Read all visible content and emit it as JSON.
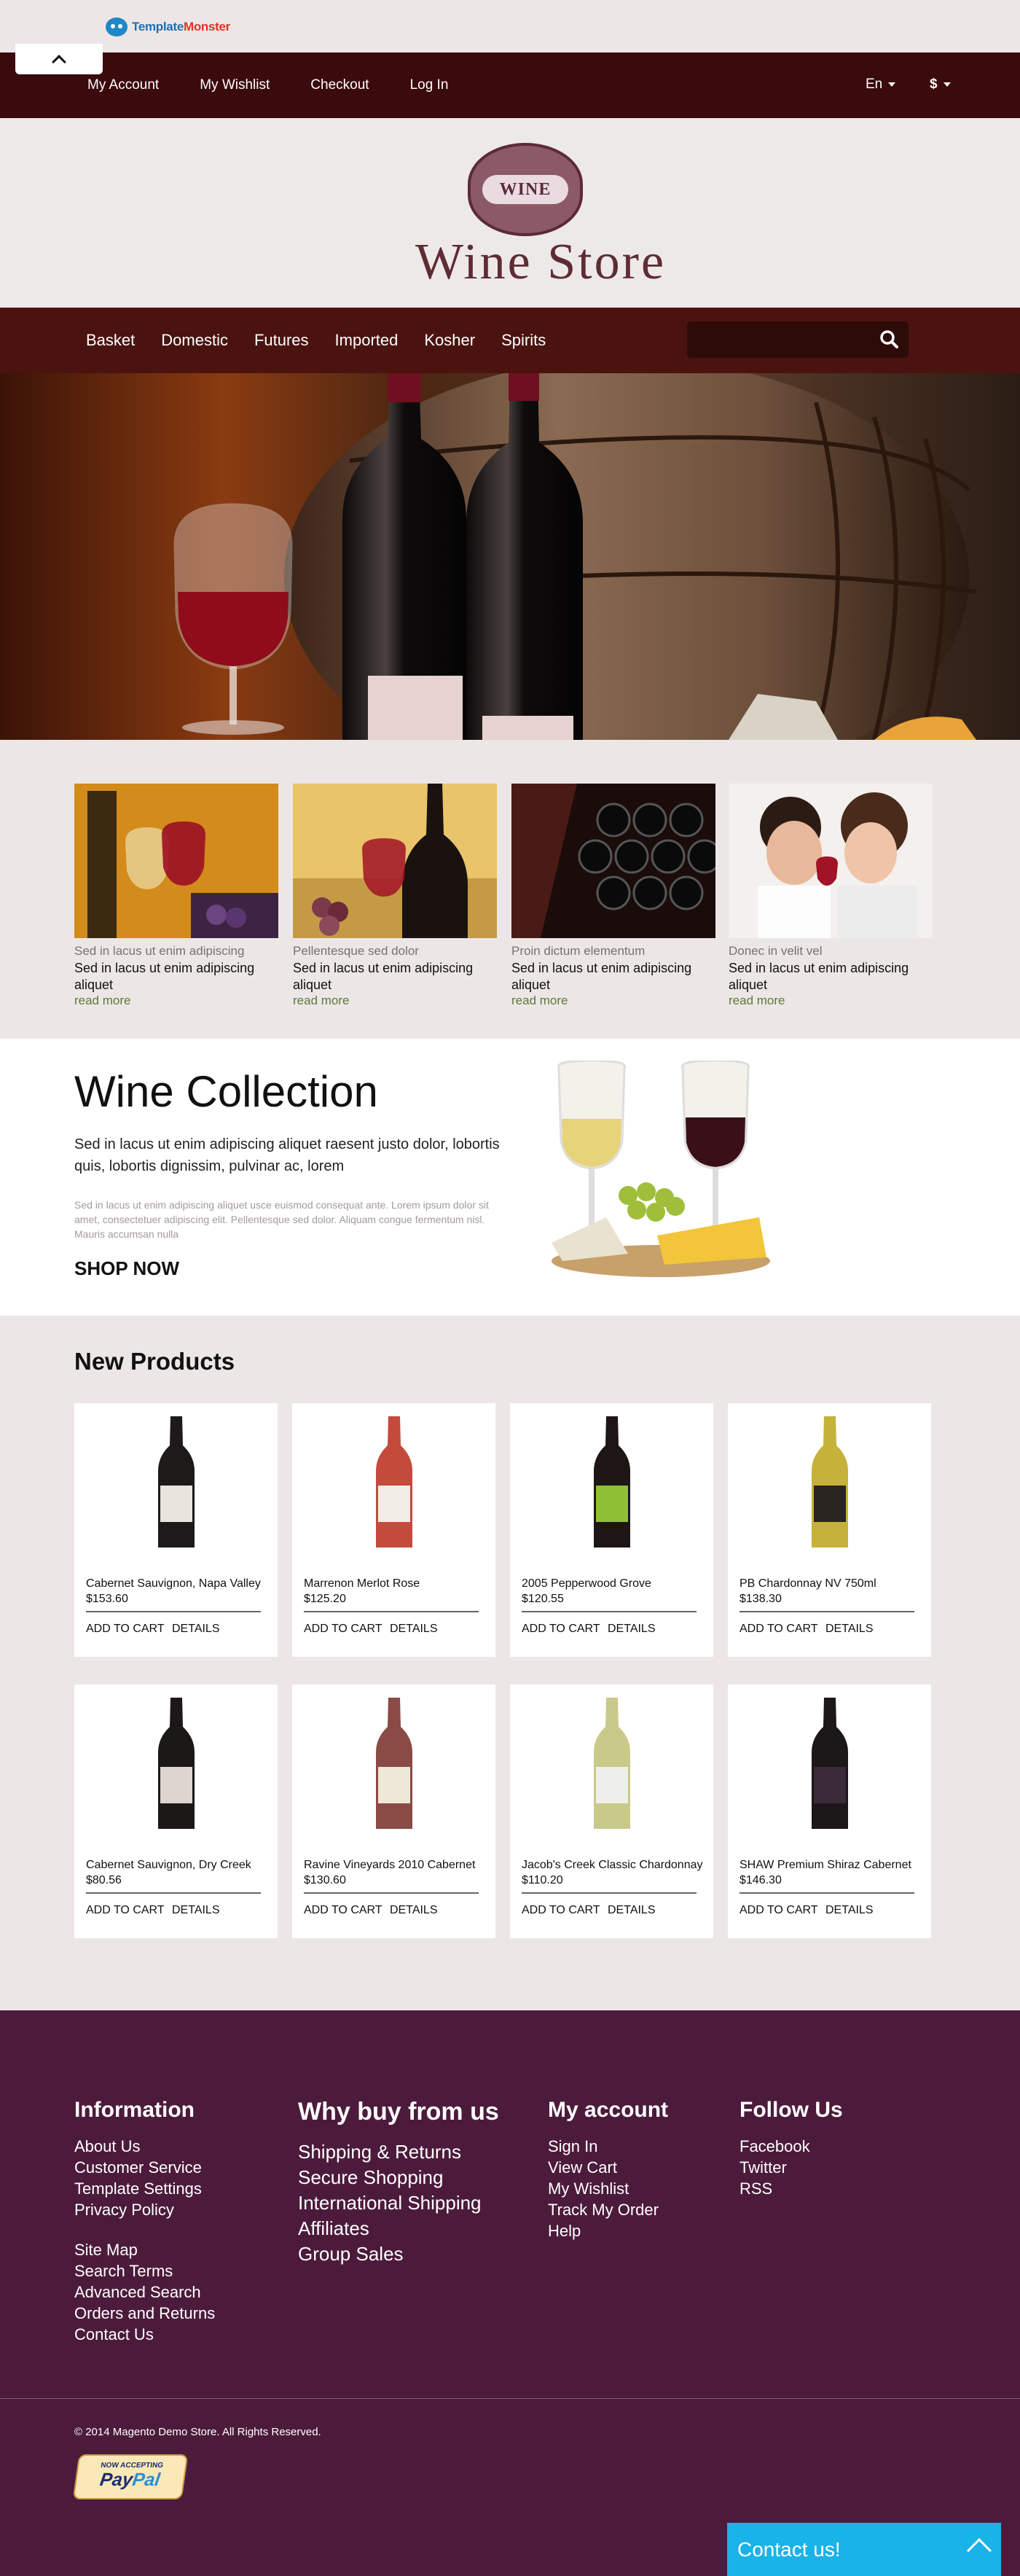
{
  "topbar": {
    "brand": "TemplateMonster",
    "brand_a": "Template",
    "brand_b": "Monster"
  },
  "account": {
    "links": [
      "My Account",
      "My Wishlist",
      "Checkout",
      "Log In"
    ],
    "language": "En",
    "currency": "$"
  },
  "header": {
    "logo_text": "WINE",
    "store_name": "Wine Store"
  },
  "categories": [
    "Basket",
    "Domestic",
    "Futures",
    "Imported",
    "Kosher",
    "Spirits"
  ],
  "search": {
    "placeholder": ""
  },
  "promos": [
    {
      "sub": "Sed in lacus ut enim adipiscing",
      "text": "Sed in lacus ut enim adipiscing aliquet",
      "more": "read more"
    },
    {
      "sub": "Pellentesque sed dolor",
      "text": "Sed in lacus ut enim adipiscing aliquet",
      "more": "read more"
    },
    {
      "sub": "Proin dictum elementum",
      "text": "Sed in lacus ut enim adipiscing aliquet",
      "more": "read more"
    },
    {
      "sub": "Donec in velit vel",
      "text": "Sed in lacus ut enim adipiscing aliquet",
      "more": "read more"
    }
  ],
  "collection": {
    "title": "Wine Collection",
    "lead": "Sed in lacus ut enim adipiscing aliquet raesent justo dolor, lobortis quis, lobortis dignissim, pulvinar ac, lorem",
    "body": "Sed in lacus ut enim adipiscing aliquet usce euismod consequat ante. Lorem ipsum dolor sit amet, consectetuer adipiscing elit. Pellentesque sed dolor. Aliquam congue fermentum nisl. Mauris accumsan nulla",
    "cta": "SHOP NOW"
  },
  "new_products": {
    "title": "New Products",
    "add_to_cart": "ADD TO CART",
    "details": "DETAILS",
    "items": [
      {
        "name": "Cabernet Sauvignon, Napa Valley",
        "price": "$153.60",
        "glass": "#1d1a1a",
        "label": "#e9e4dc"
      },
      {
        "name": "Marrenon Merlot Rose",
        "price": "$125.20",
        "glass": "#c44a3c",
        "label": "#f1ece6"
      },
      {
        "name": "2005 Pepperwood Grove",
        "price": "$120.55",
        "glass": "#1e1614",
        "label": "#8fbf35"
      },
      {
        "name": "PB Chardonnay NV 750ml",
        "price": "$138.30",
        "glass": "#c6b13a",
        "label": "#2a2521"
      },
      {
        "name": "Cabernet Sauvignon, Dry Creek",
        "price": "$80.56",
        "glass": "#1b1817",
        "label": "#dcd6cf"
      },
      {
        "name": "Ravine Vineyards 2010 Cabernet",
        "price": "$130.60",
        "glass": "#8a4a45",
        "label": "#efe7d8"
      },
      {
        "name": "Jacob's Creek Classic Chardonnay",
        "price": "$110.20",
        "glass": "#c9c98a",
        "label": "#eeeeea"
      },
      {
        "name": "SHAW Premium Shiraz Cabernet",
        "price": "$146.30",
        "glass": "#1c1718",
        "label": "#3a2a3a"
      }
    ]
  },
  "footer": {
    "information": {
      "title": "Information",
      "links": [
        "About Us",
        "Customer Service",
        "Template Settings",
        "Privacy Policy"
      ],
      "links2": [
        "Site Map",
        "Search Terms",
        "Advanced Search",
        "Orders and Returns",
        "Contact Us"
      ]
    },
    "why": {
      "title": "Why buy from us",
      "links": [
        "Shipping & Returns",
        "Secure Shopping",
        "International Shipping",
        "Affiliates",
        "Group Sales"
      ]
    },
    "my_account": {
      "title": "My account",
      "links": [
        "Sign In",
        "View Cart",
        "My Wishlist",
        "Track My Order",
        "Help"
      ]
    },
    "follow": {
      "title": "Follow Us",
      "links": [
        "Facebook",
        "Twitter",
        "RSS"
      ]
    },
    "copyright": "© 2014 Magento Demo Store. All Rights Reserved.",
    "paypal_accepting": "NOW ACCEPTING",
    "paypal_a": "Pay",
    "paypal_b": "Pal"
  },
  "contact": {
    "label": "Contact us!"
  },
  "colors": {
    "account_bar": "#3b0a0d",
    "category_nav": "#4b1310",
    "footer": "#4c1b3b",
    "contact": "#19b3e8",
    "read_more": "#5b7a3b"
  }
}
